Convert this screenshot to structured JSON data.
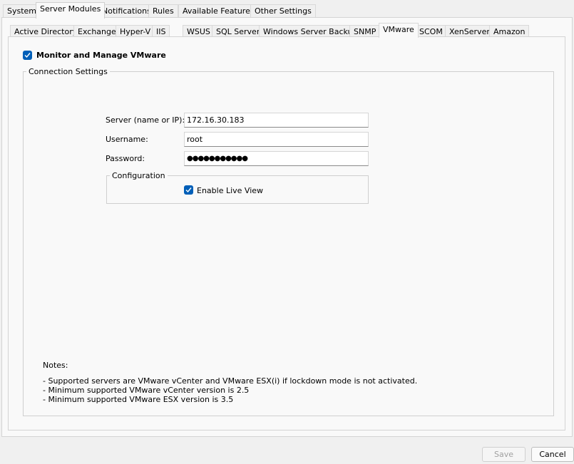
{
  "main_tabs": [
    "System",
    "Server Modules",
    "Notifications",
    "Rules",
    "Available Features",
    "Other Settings"
  ],
  "main_tab_active": "Server Modules",
  "sub_tabs": [
    "Active Directory",
    "Exchange",
    "Hyper-V",
    "IIS",
    "WSUS",
    "SQL Server",
    "Windows Server Backup",
    "SNMP",
    "VMware",
    "SCOM",
    "XenServer",
    "Amazon"
  ],
  "sub_tab_active": "VMware",
  "monitor": {
    "label": "Monitor and Manage VMware",
    "checked": true
  },
  "connection": {
    "legend": "Connection Settings",
    "server_label": "Server (name or IP):",
    "server_value": "172.16.30.183",
    "username_label": "Username:",
    "username_value": "root",
    "password_label": "Password:",
    "password_value": "●●●●●●●●●●●"
  },
  "configuration": {
    "legend": "Configuration",
    "live_view_label": "Enable Live View",
    "live_view_checked": true
  },
  "notes": {
    "title": "Notes:",
    "lines": [
      "- Supported servers are VMware vCenter and VMware ESX(i) if lockdown mode is not activated.",
      "- Minimum supported VMware vCenter version is 2.5",
      "- Minimum supported VMware ESX version is 3.5"
    ]
  },
  "buttons": {
    "save": "Save",
    "cancel": "Cancel"
  },
  "colors": {
    "accent": "#005fb8"
  }
}
